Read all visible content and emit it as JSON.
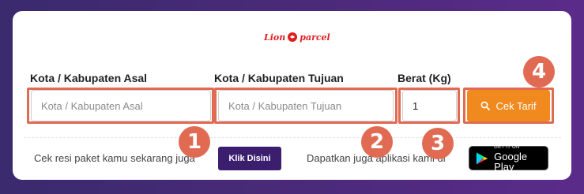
{
  "brand": {
    "logo_text_1": "Lion",
    "logo_text_2": "parcel"
  },
  "form": {
    "origin_label": "Kota / Kabupaten Asal",
    "origin_placeholder": "Kota / Kabupaten Asal",
    "destination_label": "Kota / Kabupaten Tujuan",
    "destination_placeholder": "Kota / Kabupaten Tujuan",
    "weight_label": "Berat (Kg)",
    "weight_value": "1",
    "submit_label": "Cek Tarif"
  },
  "footer": {
    "resi_text": "Cek resi paket kamu sekarang juga",
    "resi_button": "Klik Disini",
    "app_text": "Dapatkan juga aplikasi kami di",
    "store_small": "GET IT ON",
    "store_big": "Google Play"
  },
  "annotations": [
    "1",
    "2",
    "3",
    "4"
  ],
  "colors": {
    "highlight": "#e06a52",
    "submit": "#f08a1e",
    "resi_button": "#3b1f6e",
    "brand_red": "#e0201f"
  },
  "icons": {
    "submit": "search-icon",
    "store": "google-play-icon",
    "logo": "lion-icon"
  }
}
